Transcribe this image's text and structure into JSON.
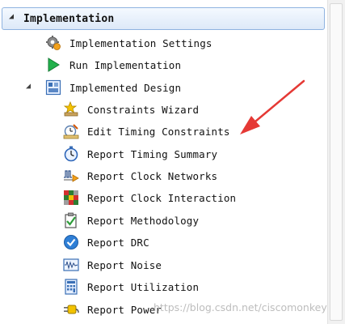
{
  "header": {
    "title": "Implementation"
  },
  "items": [
    {
      "label": "Implementation Settings",
      "icon": "gear-icon"
    },
    {
      "label": "Run Implementation",
      "icon": "play-icon"
    },
    {
      "label": "Implemented Design",
      "icon": "design-icon"
    },
    {
      "label": "Constraints Wizard",
      "icon": "wizard-icon"
    },
    {
      "label": "Edit Timing Constraints",
      "icon": "timing-edit-icon"
    },
    {
      "label": "Report Timing Summary",
      "icon": "stopwatch-icon"
    },
    {
      "label": "Report Clock Networks",
      "icon": "clock-network-icon"
    },
    {
      "label": "Report Clock Interaction",
      "icon": "clock-interaction-icon"
    },
    {
      "label": "Report Methodology",
      "icon": "clipboard-check-icon"
    },
    {
      "label": "Report DRC",
      "icon": "check-circle-icon"
    },
    {
      "label": "Report Noise",
      "icon": "noise-icon"
    },
    {
      "label": "Report Utilization",
      "icon": "utilization-icon"
    },
    {
      "label": "Report Power",
      "icon": "power-plug-icon"
    }
  ],
  "watermark": "https://blog.csdn.net/ciscomonkey",
  "colors": {
    "header_border": "#8fb3e0",
    "annotation_arrow": "#e53935"
  }
}
